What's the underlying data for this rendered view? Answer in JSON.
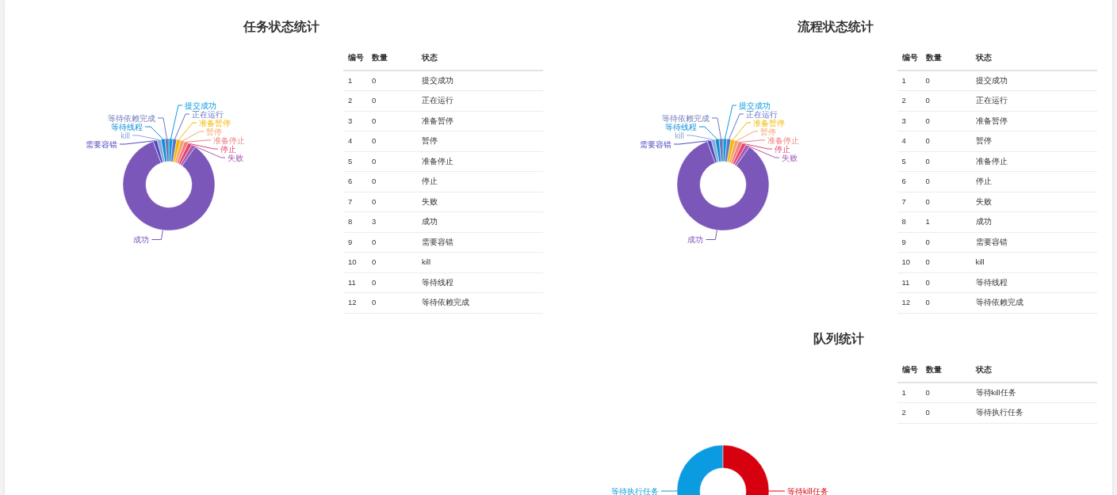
{
  "panels": [
    {
      "title": "任务状态统计",
      "chart": {
        "slices": [
          {
            "label": "提交成功",
            "color": "#0a9be0",
            "kind": "right"
          },
          {
            "label": "正在运行",
            "color": "#5f73c4",
            "kind": "right"
          },
          {
            "label": "等待依赖完成",
            "color": "#6c79b8",
            "kind": "left"
          },
          {
            "label": "准备暂停",
            "color": "#f5b800",
            "kind": "right"
          },
          {
            "label": "等待线程",
            "color": "#0a8fd6",
            "kind": "left"
          },
          {
            "label": "暂停",
            "color": "#f5a46a",
            "kind": "right"
          },
          {
            "label": "kill",
            "color": "#8fa7d8",
            "kind": "left"
          },
          {
            "label": "准备停止",
            "color": "#f07f7f",
            "kind": "right"
          },
          {
            "label": "需要容错",
            "color": "#4f49c0",
            "kind": "left"
          },
          {
            "label": "停止",
            "color": "#e8416c",
            "kind": "right"
          },
          {
            "label": "失败",
            "color": "#a35bb5",
            "kind": "right"
          },
          {
            "label": "成功",
            "color": "#7b57b9",
            "kind": "main"
          }
        ]
      },
      "table": {
        "columns": [
          "编号",
          "数量",
          "状态"
        ],
        "rows": [
          [
            "1",
            "0",
            "提交成功"
          ],
          [
            "2",
            "0",
            "正在运行"
          ],
          [
            "3",
            "0",
            "准备暂停"
          ],
          [
            "4",
            "0",
            "暂停"
          ],
          [
            "5",
            "0",
            "准备停止"
          ],
          [
            "6",
            "0",
            "停止"
          ],
          [
            "7",
            "0",
            "失败"
          ],
          [
            "8",
            "3",
            "成功"
          ],
          [
            "9",
            "0",
            "需要容错"
          ],
          [
            "10",
            "0",
            "kill"
          ],
          [
            "11",
            "0",
            "等待线程"
          ],
          [
            "12",
            "0",
            "等待依赖完成"
          ]
        ]
      }
    },
    {
      "title": "流程状态统计",
      "chart": {
        "slices": [
          {
            "label": "提交成功",
            "color": "#0a9be0",
            "kind": "right"
          },
          {
            "label": "正在运行",
            "color": "#5f73c4",
            "kind": "right"
          },
          {
            "label": "等待依赖完成",
            "color": "#6c79b8",
            "kind": "left"
          },
          {
            "label": "准备暂停",
            "color": "#f5b800",
            "kind": "right"
          },
          {
            "label": "等待线程",
            "color": "#0a8fd6",
            "kind": "left"
          },
          {
            "label": "暂停",
            "color": "#f5a46a",
            "kind": "right"
          },
          {
            "label": "kill",
            "color": "#8fa7d8",
            "kind": "left"
          },
          {
            "label": "准备停止",
            "color": "#f07f7f",
            "kind": "right"
          },
          {
            "label": "需要容错",
            "color": "#4f49c0",
            "kind": "left"
          },
          {
            "label": "停止",
            "color": "#e8416c",
            "kind": "right"
          },
          {
            "label": "失败",
            "color": "#a35bb5",
            "kind": "right"
          },
          {
            "label": "成功",
            "color": "#7b57b9",
            "kind": "main"
          }
        ]
      },
      "table": {
        "columns": [
          "编号",
          "数量",
          "状态"
        ],
        "rows": [
          [
            "1",
            "0",
            "提交成功"
          ],
          [
            "2",
            "0",
            "正在运行"
          ],
          [
            "3",
            "0",
            "准备暂停"
          ],
          [
            "4",
            "0",
            "暂停"
          ],
          [
            "5",
            "0",
            "准备停止"
          ],
          [
            "6",
            "0",
            "停止"
          ],
          [
            "7",
            "0",
            "失败"
          ],
          [
            "8",
            "1",
            "成功"
          ],
          [
            "9",
            "0",
            "需要容错"
          ],
          [
            "10",
            "0",
            "kill"
          ],
          [
            "11",
            "0",
            "等待线程"
          ],
          [
            "12",
            "0",
            "等待依赖完成"
          ]
        ]
      }
    },
    {
      "title": "队列统计",
      "chart": {
        "slices": [
          {
            "label": "等待执行任务",
            "color": "#0a9be0",
            "kind": "west"
          },
          {
            "label": "等待kill任务",
            "color": "#d7000f",
            "kind": "east"
          }
        ]
      },
      "table": {
        "columns": [
          "编号",
          "数量",
          "状态"
        ],
        "rows": [
          [
            "1",
            "0",
            "等待kill任务"
          ],
          [
            "2",
            "0",
            "等待执行任务"
          ]
        ]
      }
    }
  ]
}
